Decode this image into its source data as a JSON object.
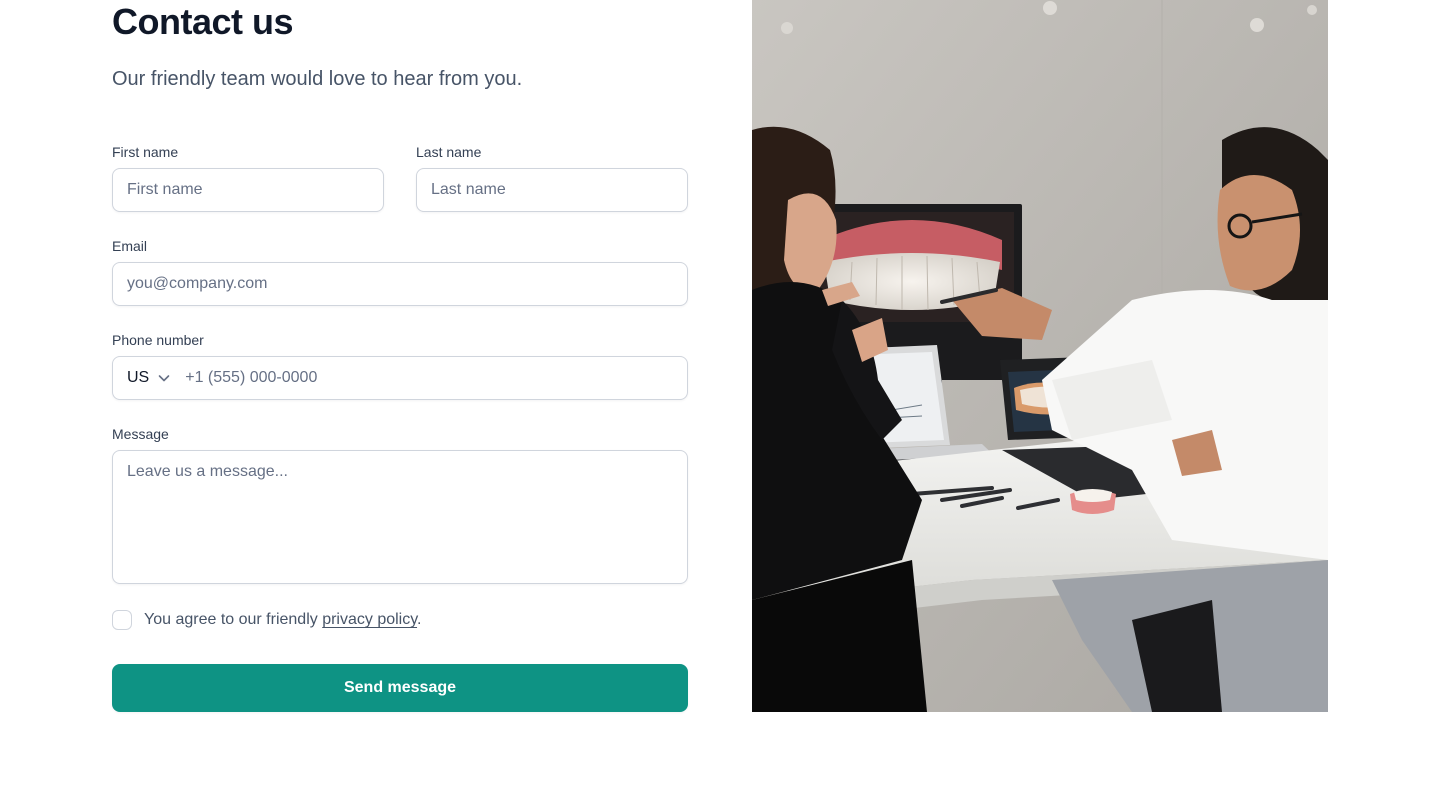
{
  "header": {
    "title": "Contact us",
    "subtitle": "Our friendly team would love to hear from you."
  },
  "form": {
    "first_name": {
      "label": "First name",
      "placeholder": "First name",
      "value": ""
    },
    "last_name": {
      "label": "Last name",
      "placeholder": "Last name",
      "value": ""
    },
    "email": {
      "label": "Email",
      "placeholder": "you@company.com",
      "value": ""
    },
    "phone": {
      "label": "Phone number",
      "country": "US",
      "placeholder": "+1 (555) 000-0000",
      "value": ""
    },
    "message": {
      "label": "Message",
      "placeholder": "Leave us a message...",
      "value": ""
    },
    "agree": {
      "prefix": "You agree to our friendly ",
      "link": "privacy policy",
      "suffix": ".",
      "checked": false
    },
    "submit_label": "Send message"
  },
  "colors": {
    "accent": "#0e9384",
    "text_primary": "#101828",
    "text_secondary": "#475467",
    "border": "#d0d5dd"
  },
  "icons": {
    "country_dropdown": "chevron-down-icon"
  }
}
